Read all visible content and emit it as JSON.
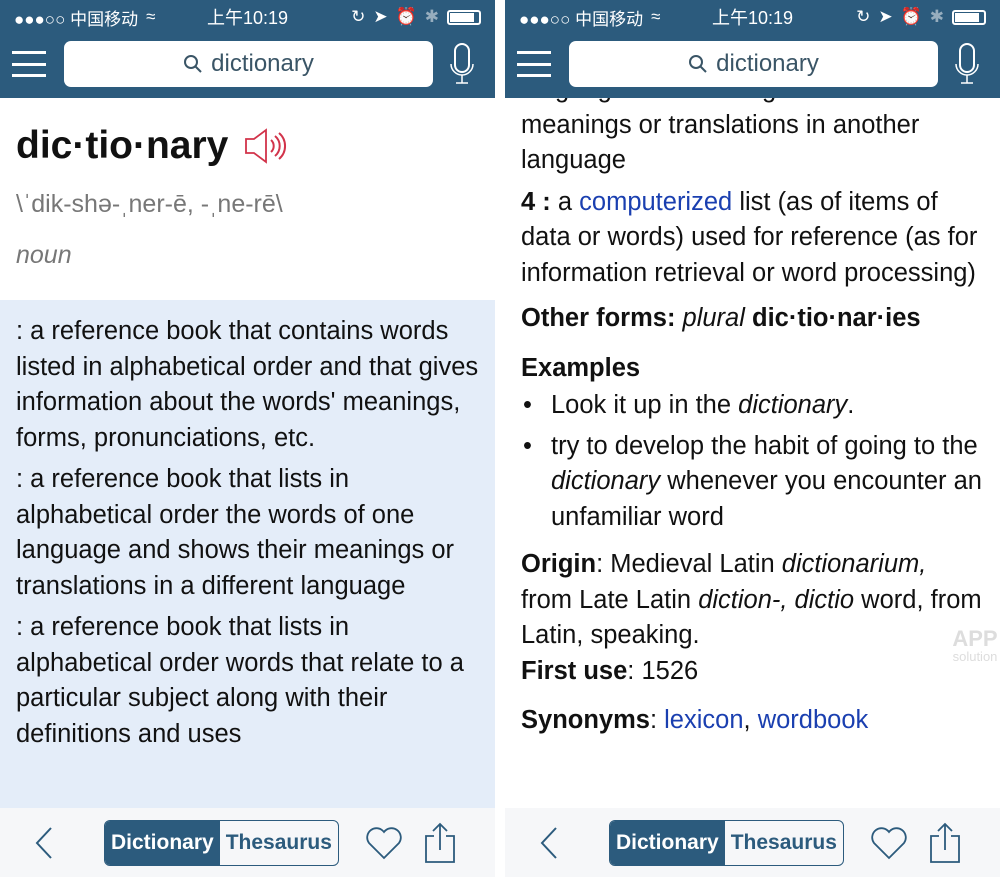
{
  "status": {
    "carrier": "●●●○○ 中国移动",
    "time": "上午10:19"
  },
  "search": {
    "value": "dictionary"
  },
  "entry": {
    "headword": "dic·tio·nary",
    "pronunciation": "\\ˈdik-shə-ˌner-ē, -ˌne-rē\\",
    "pos": "noun",
    "definitions": [
      ": a reference book that contains words listed in alphabetical order and that gives information about the words' meanings, forms, pronunciations, etc.",
      ": a reference book that lists in alphabetical order the words of one language and shows their meanings or translations in a different language",
      ": a reference book that lists in alphabetical order words that relate to a particular subject along with their definitions and uses"
    ]
  },
  "detail": {
    "cut_line": "language and showing their",
    "def3_tail": "meanings or translations in another language",
    "def4": {
      "num": "4 :",
      "pre": "a",
      "link": "computerized",
      "post": "list (as of items of data or words) used for reference (as for information retrieval or word processing)"
    },
    "other_forms": {
      "label": "Other forms:",
      "plural": "plural",
      "form": "dic·tio·nar·ies"
    },
    "examples": {
      "label": "Examples",
      "items": [
        {
          "pre": "Look it up in the ",
          "em": "dictionary",
          "post": "."
        },
        {
          "pre": "try to develop the habit of going to the ",
          "em": "dictionary",
          "post": " whenever you encounter an unfamiliar word"
        }
      ]
    },
    "origin": {
      "label": "Origin",
      "t1": ": Medieval Latin ",
      "e1": "dictionarium,",
      "t2": " from Late Latin ",
      "e2": "diction-, dictio",
      "t3": " word, from Latin, speaking."
    },
    "first_use": {
      "label": "First use",
      "value": ": 1526"
    },
    "synonyms": {
      "label": "Synonyms",
      "sep": ": ",
      "items": [
        "lexicon",
        "wordbook"
      ]
    }
  },
  "toolbar": {
    "dictionary": "Dictionary",
    "thesaurus": "Thesaurus"
  },
  "watermark": "APP solution",
  "colors": {
    "header": "#2c5b7d",
    "definition_bg": "#e4edf9",
    "link": "#1a3fb0",
    "speaker": "#d2334a"
  }
}
